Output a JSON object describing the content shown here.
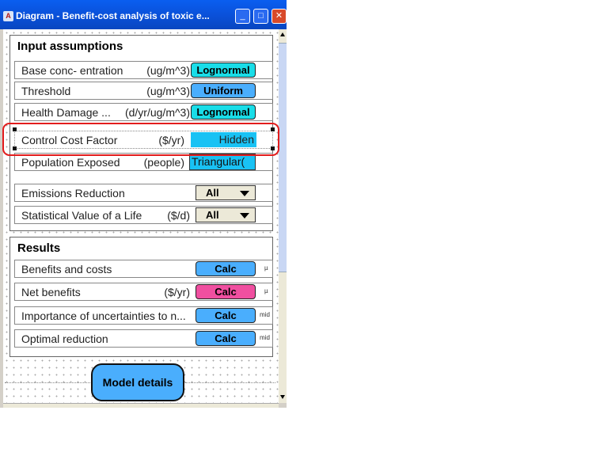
{
  "window": {
    "title": "Diagram - Benefit-cost analysis of toxic e...",
    "minimize_glyph": "_",
    "maximize_glyph": "□",
    "close_glyph": "✕"
  },
  "input_assumptions": {
    "title": "Input assumptions",
    "rows": [
      {
        "label": "Base conc-  entration",
        "units": "(ug/m^3)",
        "value": "Lognormal"
      },
      {
        "label": "Threshold",
        "units": "(ug/m^3)",
        "value": "Uniform"
      },
      {
        "label": "Health Damage ...",
        "units": "(d/yr/ug/m^3)",
        "value": "Lognormal"
      },
      {
        "label": "Control Cost Factor",
        "units": "($/yr)",
        "value": "Hidden"
      },
      {
        "label": "Population Exposed",
        "units": "(people)",
        "value": "Triangular("
      }
    ],
    "choices": [
      {
        "label": "Emissions Reduction",
        "units": "",
        "value": "All"
      },
      {
        "label": "Statistical Value of a Life",
        "units": "($/d)",
        "value": "All"
      }
    ]
  },
  "results": {
    "title": "Results",
    "rows": [
      {
        "label": "Benefits and costs",
        "units": "",
        "button": "Calc",
        "suffix": "µ"
      },
      {
        "label": "Net benefits",
        "units": "($/yr)",
        "button": "Calc",
        "suffix": "µ"
      },
      {
        "label": "Importance of uncertainties to n...",
        "units": "",
        "button": "Calc",
        "suffix": "mid"
      },
      {
        "label": "Optimal reduction",
        "units": "",
        "button": "Calc",
        "suffix": "mid"
      }
    ]
  },
  "model_details": {
    "label": "Model details"
  },
  "colors": {
    "cyan_button": "#19dde8",
    "blue_button": "#4aaefd",
    "pink_button": "#f04fa0",
    "selection_outline": "#e21c1c",
    "titlebar": "#0a5ef0"
  },
  "icons": [
    "analytica-app-icon",
    "minimize-icon",
    "maximize-icon",
    "close-icon",
    "dropdown-arrow-icon"
  ]
}
